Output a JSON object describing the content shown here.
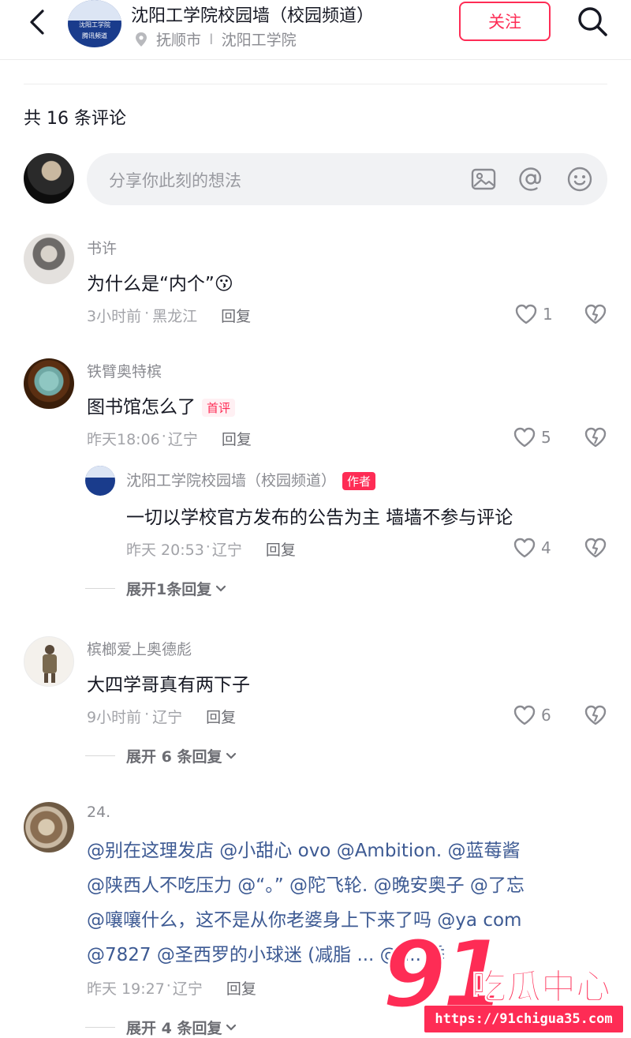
{
  "header": {
    "title": "沈阳工学院校园墙（校园频道）",
    "location_city": "抚顺市",
    "location_separator": "I",
    "location_school": "沈阳工学院",
    "follow_label": "关注",
    "logo_text": "沈阳工学院",
    "logo_badge": "腾讯频道"
  },
  "comments_count": "共 16 条评论",
  "input": {
    "placeholder": "分享你此刻的想法",
    "icons": [
      "image-icon",
      "at-icon",
      "emoji-icon"
    ]
  },
  "comments": [
    {
      "user": "书许",
      "text": "为什么是“内个”",
      "emoji": "😗",
      "time": "3小时前",
      "region": "黑龙江",
      "reply_label": "回复",
      "likes": "1"
    },
    {
      "user": "铁臂奥特槟",
      "text": "图书馆怎么了",
      "tag": "首评",
      "time": "昨天18:06",
      "region": "辽宁",
      "reply_label": "回复",
      "likes": "5",
      "reply": {
        "user": "沈阳工学院校园墙（校园频道）",
        "tag": "作者",
        "text": "一切以学校官方发布的公告为主 墙墙不参与评论",
        "time": "昨天 20:53",
        "region": "辽宁",
        "reply_label": "回复",
        "likes": "4"
      },
      "expand_label": "展开1条回复"
    },
    {
      "user": "槟榔爱上奥德彪",
      "text": "大四学哥真有两下子",
      "time": "9小时前",
      "region": "辽宁",
      "reply_label": "回复",
      "likes": "6",
      "expand_label": "展开 6 条回复"
    },
    {
      "user": "24.",
      "lines": [
        "@别在这理发店 @小甜心 ovo @Ambition. @蓝莓酱",
        "@陕西人不吃压力 @“。” @陀飞轮. @晚安奥子 @了忘",
        "@嚷嚷什么，这不是从你老婆身上下来了吗 @ya com",
        "@7827 @圣西罗的小球迷 (减脂 ... @ ... 季"
      ],
      "time": "昨天 19:27",
      "region": "辽宁",
      "reply_label": "回复",
      "expand_label": "展开 4 条回复"
    }
  ],
  "meta_separator": "·",
  "watermark": {
    "number": "91",
    "name": "吃瓜中心",
    "url": "https://91chigua35.com"
  },
  "colors": {
    "accent": "#fe2c55",
    "mention": "#3d5a93",
    "muted": "#8a8b91"
  }
}
